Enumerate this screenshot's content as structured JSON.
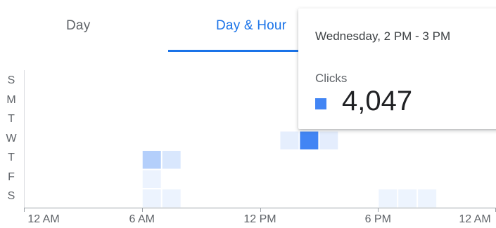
{
  "tabs": [
    {
      "label": "Day",
      "active": false
    },
    {
      "label": "Day & Hour",
      "active": true
    }
  ],
  "accent_color": "#1a73e8",
  "chart_data": {
    "type": "heatmap",
    "x_ticks": [
      "12 AM",
      "6 AM",
      "12 PM",
      "6 PM",
      "12 AM"
    ],
    "y_categories": [
      "S",
      "M",
      "T",
      "W",
      "T",
      "F",
      "S"
    ],
    "hours": [
      0,
      1,
      2,
      3,
      4,
      5,
      6,
      7,
      8,
      9,
      10,
      11,
      12,
      13,
      14,
      15,
      16,
      17,
      18,
      19,
      20,
      21,
      22,
      23
    ],
    "cell_color": "#4285f4",
    "max_value": 4047,
    "values": [
      [
        0,
        0,
        0,
        0,
        0,
        0,
        0,
        0,
        0,
        0,
        0,
        0,
        0,
        0,
        0,
        0,
        0,
        0,
        0,
        0,
        0,
        0,
        0,
        0
      ],
      [
        0,
        0,
        0,
        0,
        0,
        0,
        0,
        0,
        0,
        0,
        0,
        0,
        0,
        0,
        0,
        0,
        0,
        0,
        0,
        0,
        0,
        0,
        0,
        0
      ],
      [
        0,
        0,
        0,
        0,
        0,
        0,
        0,
        0,
        0,
        0,
        0,
        0,
        0,
        0,
        0,
        0,
        0,
        0,
        0,
        0,
        0,
        0,
        0,
        0
      ],
      [
        0,
        0,
        0,
        0,
        0,
        0,
        0,
        0,
        0,
        0,
        0,
        0,
        0,
        260,
        4047,
        280,
        0,
        0,
        0,
        0,
        0,
        0,
        0,
        0
      ],
      [
        0,
        0,
        0,
        0,
        0,
        0,
        1400,
        530,
        0,
        0,
        0,
        0,
        0,
        0,
        0,
        0,
        0,
        0,
        0,
        0,
        0,
        0,
        0,
        0
      ],
      [
        0,
        0,
        0,
        0,
        0,
        0,
        90,
        0,
        0,
        0,
        0,
        0,
        0,
        0,
        0,
        0,
        0,
        0,
        0,
        0,
        0,
        0,
        0,
        0
      ],
      [
        0,
        0,
        0,
        0,
        0,
        0,
        90,
        90,
        0,
        0,
        0,
        0,
        0,
        0,
        0,
        0,
        0,
        0,
        70,
        70,
        70,
        0,
        0,
        0
      ]
    ]
  },
  "tooltip": {
    "title": "Wednesday, 2 PM - 3 PM",
    "metric": "Clicks",
    "value": "4,047",
    "swatch_color": "#4285f4"
  }
}
